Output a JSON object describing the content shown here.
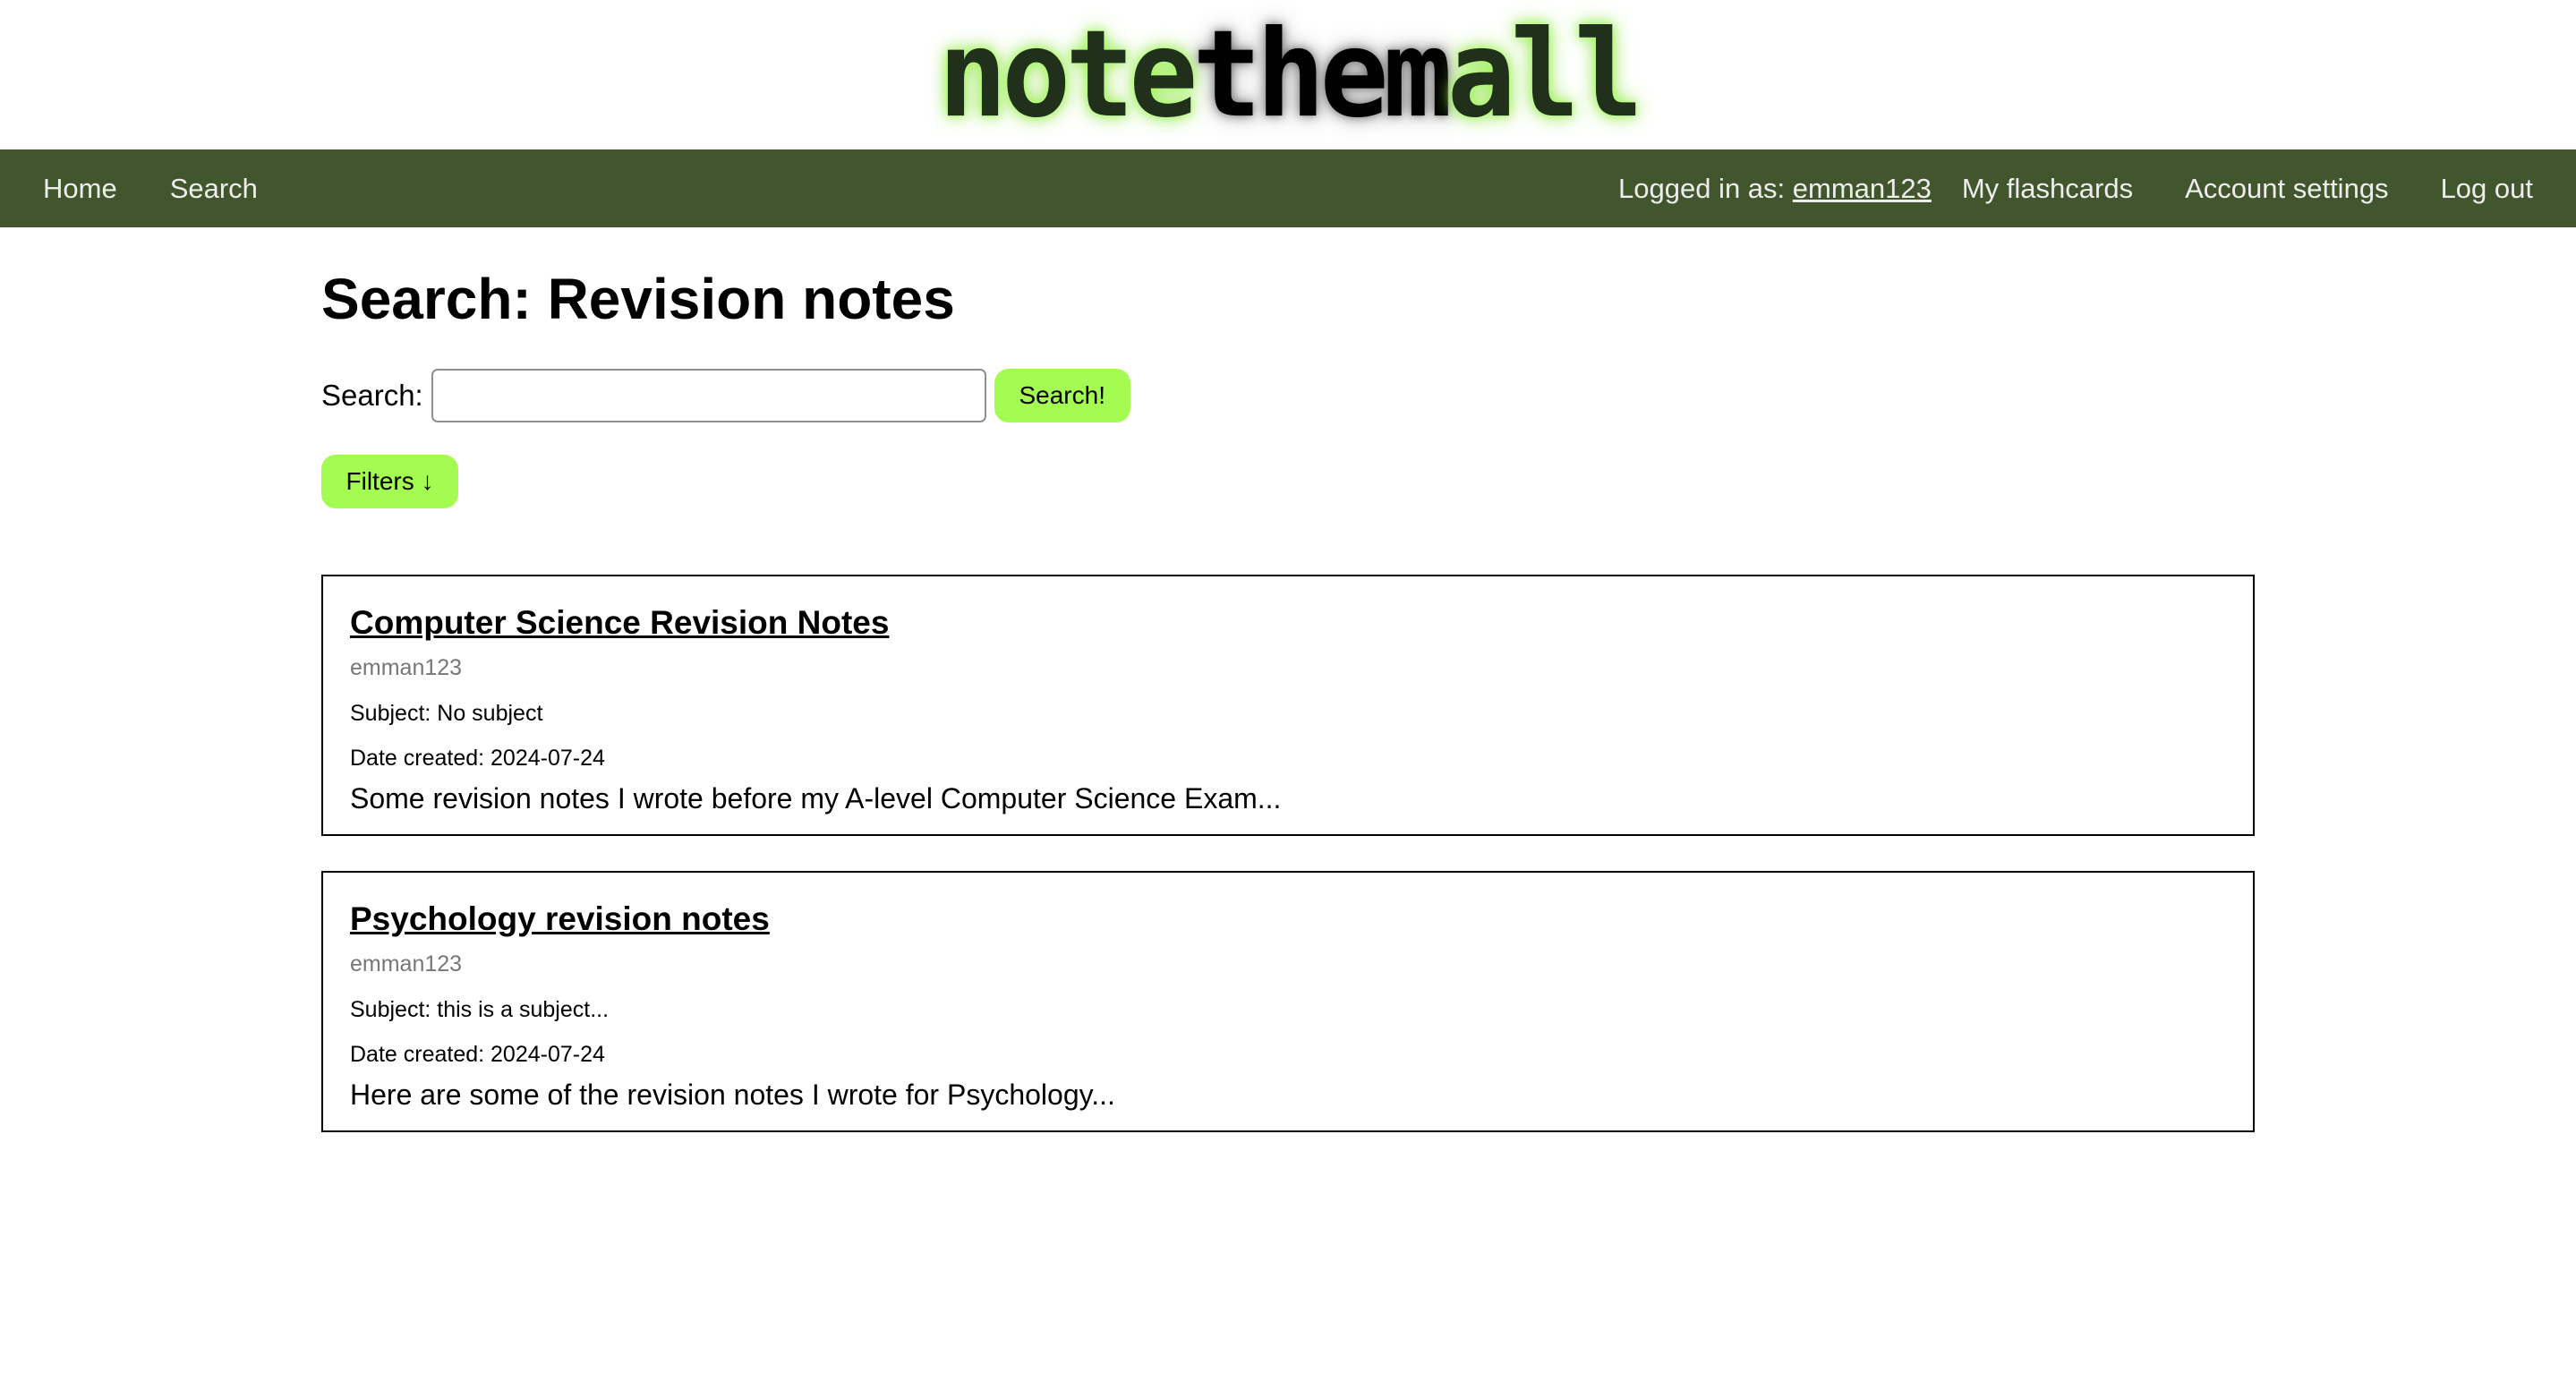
{
  "header": {
    "logo": {
      "part1": "note",
      "part2": "them",
      "part3": "all"
    }
  },
  "nav": {
    "home": "Home",
    "search": "Search",
    "logged_in_label": "Logged in as: ",
    "username": "emman123",
    "flashcards": "My flashcards",
    "account_settings": "Account settings",
    "logout": "Log out"
  },
  "main": {
    "title": "Search: Revision notes",
    "search_label": "Search:",
    "search_value": "",
    "search_button": "Search!",
    "filters_button": "Filters ↓"
  },
  "results": [
    {
      "title": "Computer Science Revision Notes",
      "author": "emman123",
      "subject": "Subject: No subject",
      "date": "Date created: 2024-07-24",
      "description": "Some revision notes I wrote before my A-level Computer Science Exam..."
    },
    {
      "title": "Psychology revision notes",
      "author": "emman123",
      "subject": "Subject: this is a subject...",
      "date": "Date created: 2024-07-24",
      "description": "Here are some of the revision notes I wrote for Psychology..."
    }
  ],
  "colors": {
    "nav_bg": "#41562d",
    "button_bg": "#a4fc52",
    "logo_glow": "#a8ff60"
  }
}
